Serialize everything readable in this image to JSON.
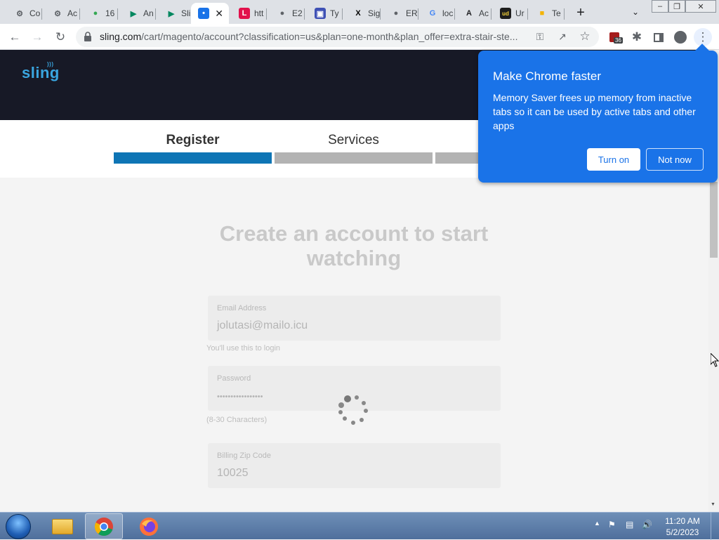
{
  "tabs": [
    {
      "title": "Co",
      "icon": "gear-icon",
      "color": "#5f6368"
    },
    {
      "title": "Ac",
      "icon": "gear-icon",
      "color": "#5f6368"
    },
    {
      "title": "16",
      "icon": "map-pin-icon",
      "color": "#34a853"
    },
    {
      "title": "An",
      "icon": "play-store-icon",
      "color": "#01875f"
    },
    {
      "title": "Sli",
      "icon": "play-store-icon",
      "color": "#01875f"
    },
    {
      "title": "",
      "icon": "sling-icon",
      "color": "#1a73e8",
      "active": true
    },
    {
      "title": "htt",
      "icon": "l-logo-icon",
      "color": "#e2114c"
    },
    {
      "title": "E2",
      "icon": "globe-icon",
      "color": "#5f6368"
    },
    {
      "title": "Ty",
      "icon": "flag-icon",
      "color": "#3f51b5"
    },
    {
      "title": "Sig",
      "icon": "x-logo-icon",
      "color": "#000000"
    },
    {
      "title": "ER",
      "icon": "globe-icon",
      "color": "#5f6368"
    },
    {
      "title": "loc",
      "icon": "google-icon",
      "color": "#4285f4"
    },
    {
      "title": "Ac",
      "icon": "a-logo-icon",
      "color": "#202124"
    },
    {
      "title": "Ur",
      "icon": "ud-logo-icon",
      "color": "#1d1d1d"
    },
    {
      "title": "Te",
      "icon": "folder-icon",
      "color": "#f4b400"
    }
  ],
  "toolbar": {
    "url_host": "sling.com",
    "url_path": "/cart/magento/account?classification=us&plan=one-month&plan_offer=extra-stair-ste...",
    "extension_badge": "36"
  },
  "site": {
    "logo": "sling",
    "steps": [
      {
        "label": "Register",
        "state": "active",
        "color": "#0e75b5"
      },
      {
        "label": "Services",
        "state": "inactive",
        "color": "#b3b3b3"
      },
      {
        "label": "",
        "state": "inactive",
        "color": "#b3b3b3"
      }
    ],
    "headline": "Create an account to start watching",
    "email": {
      "label": "Email Address",
      "value": "jolutasi@mailo.icu",
      "hint": "You'll use this to login"
    },
    "password": {
      "label": "Password",
      "value": "•••••••••••••••••",
      "hint": "(8-30 Characters)"
    },
    "zip": {
      "label": "Billing Zip Code",
      "value": "10025"
    }
  },
  "popup": {
    "title": "Make Chrome faster",
    "body": "Memory Saver frees up memory from inactive tabs so it can be used by active tabs and other apps",
    "turn_on": "Turn on",
    "not_now": "Not now",
    "color": "#1a73e8"
  },
  "taskbar": {
    "time": "11:20 AM",
    "date": "5/2/2023"
  }
}
